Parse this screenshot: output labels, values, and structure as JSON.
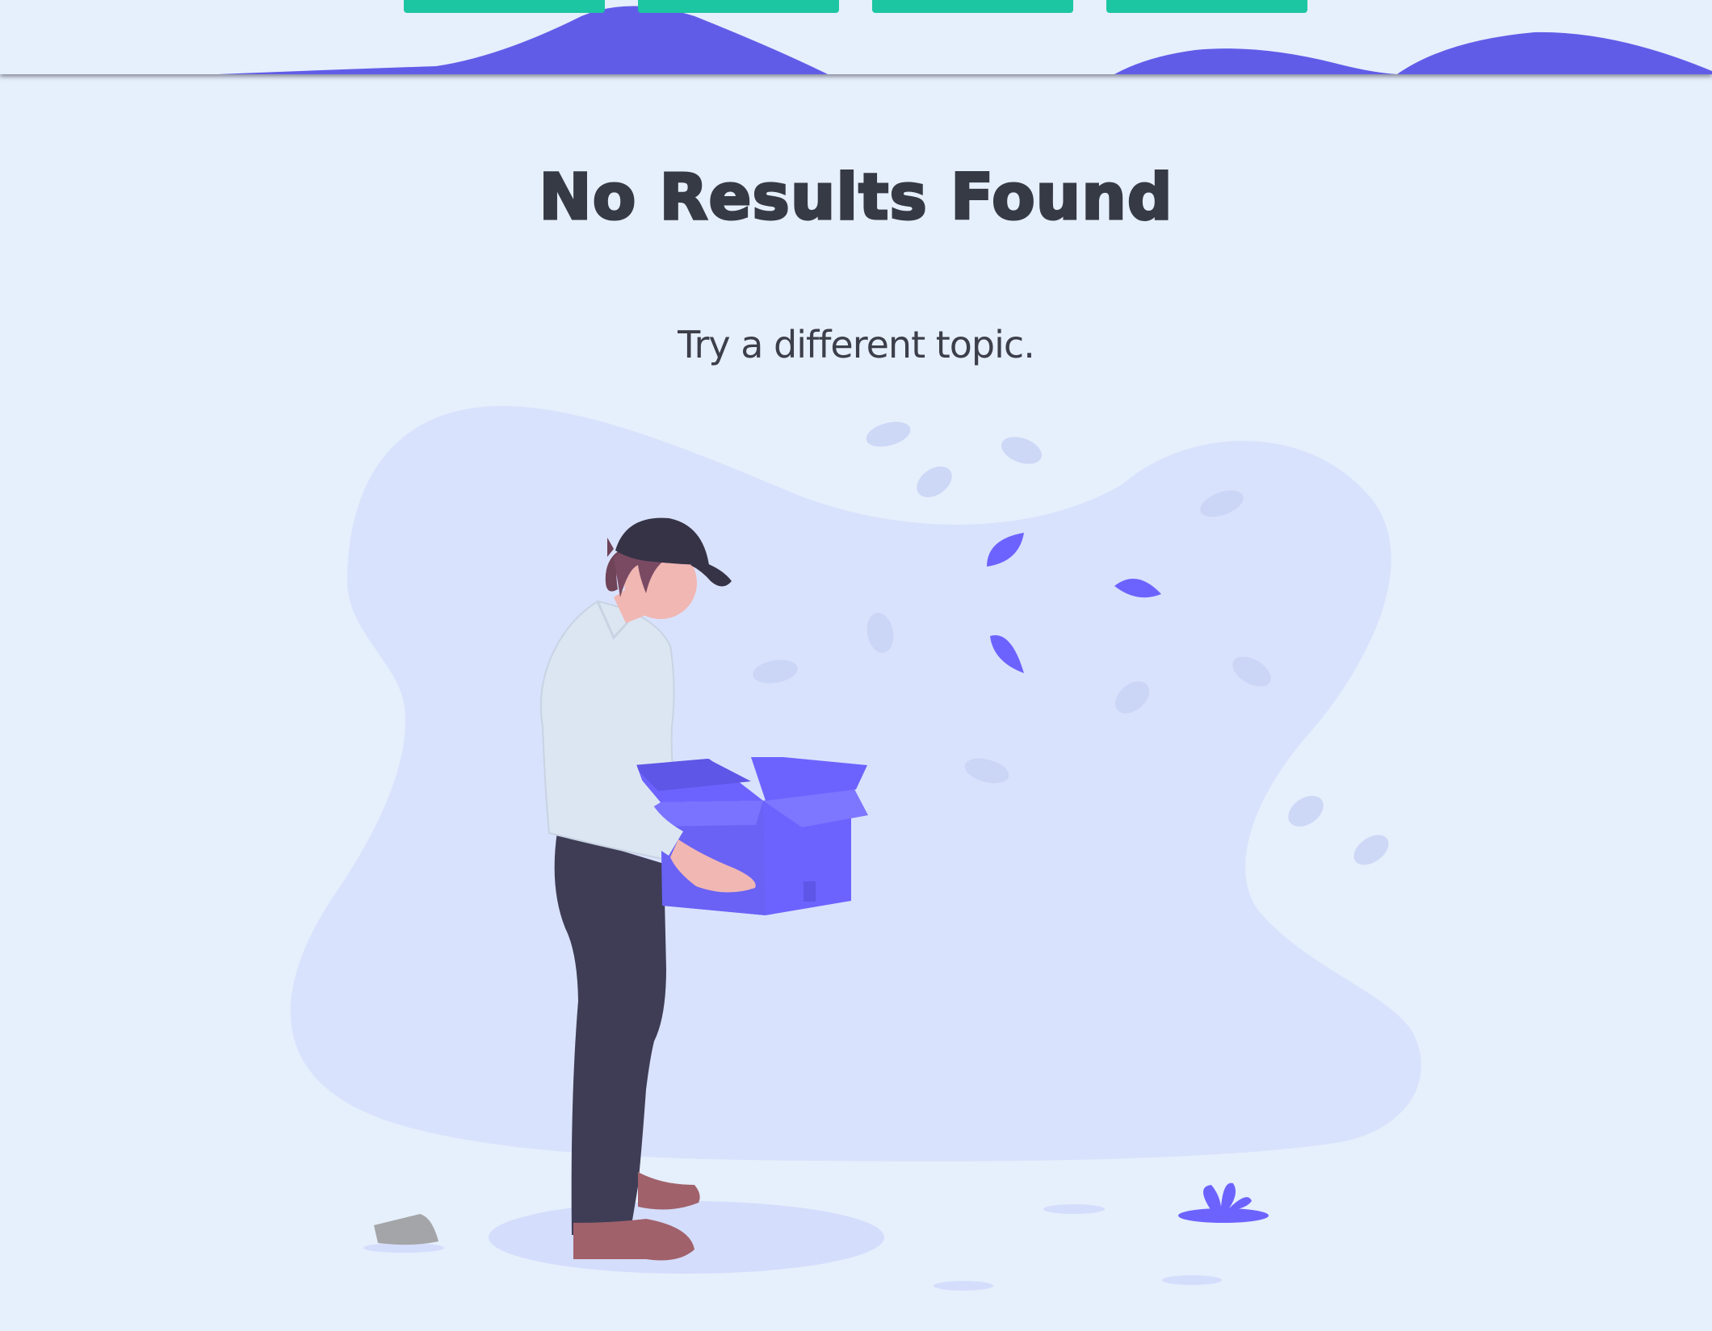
{
  "header": {
    "nav_buttons": [
      {
        "name": "nav-button-1"
      },
      {
        "name": "nav-button-2"
      },
      {
        "name": "nav-button-3"
      },
      {
        "name": "nav-button-4"
      }
    ],
    "wave_color": "#615ce8",
    "button_color": "#1cc6a2"
  },
  "empty_state": {
    "title": "No Results Found",
    "message": "Try a different topic."
  },
  "illustration": {
    "name": "empty-box-illustration",
    "accent_color": "#6c63ff",
    "blob_color": "#d9e2fc"
  }
}
